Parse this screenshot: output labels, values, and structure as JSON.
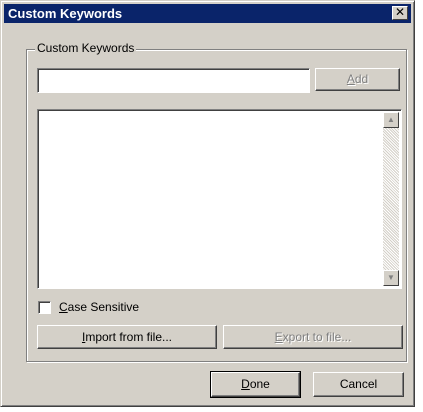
{
  "window": {
    "title": "Custom Keywords",
    "close_glyph": "✕"
  },
  "group": {
    "legend": "Custom Keywords"
  },
  "keyword_input": {
    "value": "",
    "placeholder": ""
  },
  "buttons": {
    "add": {
      "label": "Add",
      "accel": "A",
      "rest": "dd",
      "enabled": false
    },
    "import": {
      "label": "Import from file...",
      "accel": "I",
      "rest": "mport from file...",
      "enabled": true
    },
    "export": {
      "label": "Export to file...",
      "accel": "E",
      "rest": "xport to file...",
      "enabled": false
    },
    "done": {
      "label": "Done",
      "accel": "D",
      "rest": "one",
      "enabled": true
    },
    "cancel": {
      "label": "Cancel",
      "enabled": true
    }
  },
  "keyword_list": {
    "items": []
  },
  "case_sensitive": {
    "label": "Case Sensitive",
    "accel": "C",
    "rest": "ase Sensitive",
    "checked": false
  },
  "icons": {
    "close": "close-icon",
    "scroll_up": "scroll-up-arrow-icon",
    "scroll_down": "scroll-down-arrow-icon"
  },
  "colors": {
    "titlebar": "#0a246a",
    "face": "#d4d0c8",
    "disabled_text": "#808080"
  }
}
